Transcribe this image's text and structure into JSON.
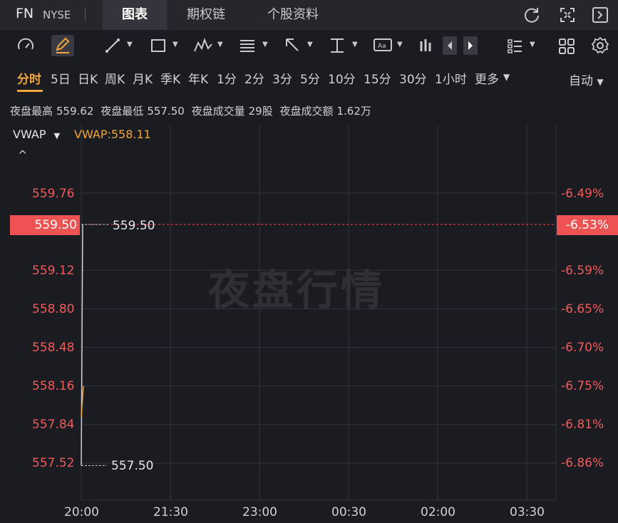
{
  "header": {
    "symbol": "FN",
    "exchange": "NYSE",
    "tabs": [
      {
        "label": "图表",
        "active": true
      },
      {
        "label": "期权链",
        "active": false
      },
      {
        "label": "个股资料",
        "active": false
      }
    ],
    "icons": [
      "refresh-icon",
      "expand-icon",
      "collapse-panel-icon"
    ]
  },
  "toolbar": {
    "icons": [
      "gauge-icon",
      "pen-icon",
      "line-tool-icon",
      "rectangle-tool-icon",
      "pattern-tool-icon",
      "fib-tool-icon",
      "arrow-tool-icon",
      "measure-tool-icon",
      "text-tool-icon",
      "indicator-icon",
      "arrow-left-icon",
      "arrow-right-icon",
      "layout-list-icon",
      "grid-icon",
      "settings-icon"
    ]
  },
  "periods": {
    "items": [
      "分时",
      "5日",
      "日K",
      "周K",
      "月K",
      "季K",
      "年K",
      "1分",
      "2分",
      "3分",
      "5分",
      "10分",
      "15分",
      "30分",
      "1小时",
      "更多"
    ],
    "active": "分时",
    "mode": "自动"
  },
  "stats": {
    "night_high_label": "夜盘最高",
    "night_high": "559.62",
    "night_low_label": "夜盘最低",
    "night_low": "557.50",
    "night_volume_label": "夜盘成交量",
    "night_volume": "29股",
    "night_amount_label": "夜盘成交额",
    "night_amount": "1.62万"
  },
  "chart": {
    "indicator": "VWAP",
    "indicator_value": "VWAP:558.11",
    "watermark": "夜盘行情",
    "current_price": "559.50",
    "current_pct": "-6.53%",
    "high_label": "559.50",
    "low_label": "557.50",
    "price_color": "#ee5353",
    "vwap_color": "#f0a63b"
  },
  "chart_data": {
    "type": "line",
    "y_ticks": [
      "559.76",
      "559.12",
      "558.80",
      "558.48",
      "558.16",
      "557.84",
      "557.52"
    ],
    "pct_ticks": [
      "-6.49%",
      "-6.59%",
      "-6.65%",
      "-6.70%",
      "-6.75%",
      "-6.81%",
      "-6.86%"
    ],
    "x_ticks": [
      "20:00",
      "21:30",
      "23:00",
      "00:30",
      "02:00",
      "03:30"
    ],
    "ylim": [
      557.4,
      559.85
    ],
    "series": [
      {
        "name": "VWAP",
        "values": [
          557.9,
          558.16
        ]
      }
    ],
    "price_series": [
      557.5,
      559.5
    ],
    "grid": true
  }
}
